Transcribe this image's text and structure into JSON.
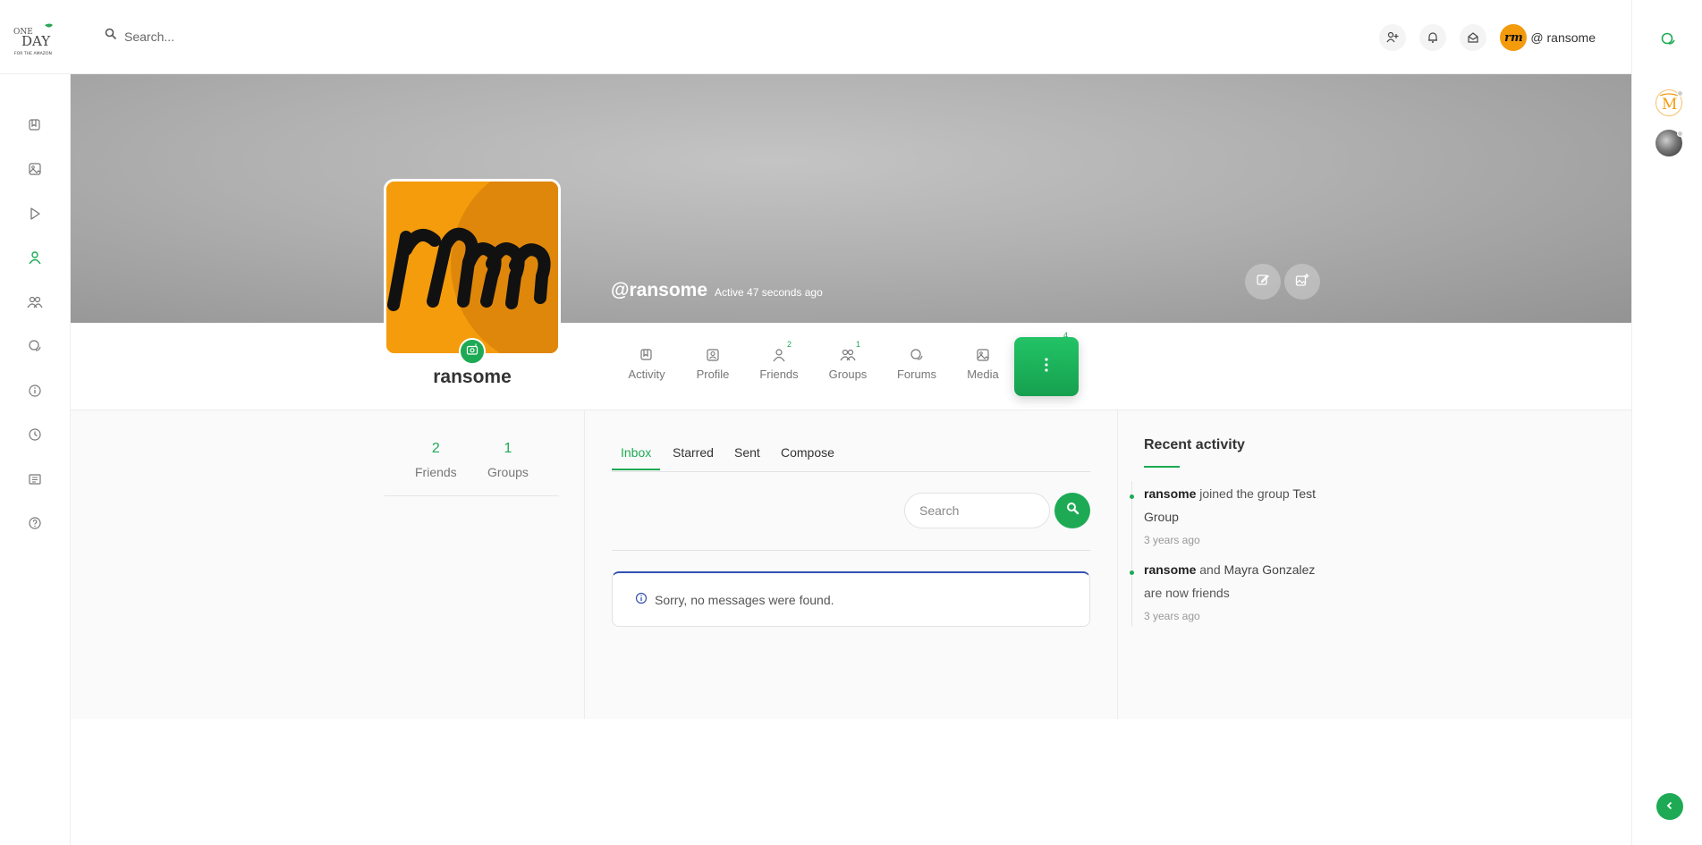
{
  "brand": {
    "logo_alt": "One Day For The Amazon",
    "logo_lines": [
      "ONE",
      "DAY",
      "FOR THE AMAZON"
    ]
  },
  "search": {
    "placeholder": "Search..."
  },
  "topbar": {
    "icons": [
      "add-friend-icon",
      "bell-icon",
      "inbox-icon"
    ],
    "user_handle": "@ ransome",
    "avatar_initials": "rm"
  },
  "leftnav": {
    "icons": [
      "activity-icon",
      "media-icon",
      "video-icon",
      "members-icon",
      "groups-icon",
      "forums-icon",
      "info-icon",
      "clock-icon",
      "news-icon",
      "help-icon"
    ],
    "active": "members-icon"
  },
  "rightbar": {
    "icons": [
      "chat-icon",
      "user-avatar",
      "user-avatar"
    ],
    "collapse": "chevron-left-icon"
  },
  "cover": {
    "handle": "@ransome",
    "status": "Active 47 seconds ago"
  },
  "profile": {
    "name": "ransome"
  },
  "profile_nav": [
    {
      "label": "Activity",
      "count": ""
    },
    {
      "label": "Profile",
      "count": ""
    },
    {
      "label": "Friends",
      "count": "2"
    },
    {
      "label": "Groups",
      "count": "1"
    },
    {
      "label": "Forums",
      "count": ""
    },
    {
      "label": "Media",
      "count": ""
    }
  ],
  "more": {
    "count": "4"
  },
  "stats": [
    {
      "value": "2",
      "label": "Friends"
    },
    {
      "value": "1",
      "label": "Groups"
    }
  ],
  "messages": {
    "tabs": [
      "Inbox",
      "Starred",
      "Sent",
      "Compose"
    ],
    "active_tab": "Inbox",
    "search_placeholder": "Search",
    "empty_notice": "Sorry, no messages were found."
  },
  "recent_activity": {
    "title": "Recent activity",
    "items": [
      {
        "actor": "ransome",
        "text_1": " joined the group ",
        "target": "Test Group",
        "text_2": "",
        "time": "3 years ago"
      },
      {
        "actor": "ransome",
        "text_1": " and ",
        "target": "Mayra Gonzalez",
        "text_2": " are now friends",
        "time": "3 years ago"
      }
    ]
  },
  "colors": {
    "accent": "#1eaa55",
    "notice_border": "#3451b2",
    "avatar_bg": "#f59c0c"
  }
}
